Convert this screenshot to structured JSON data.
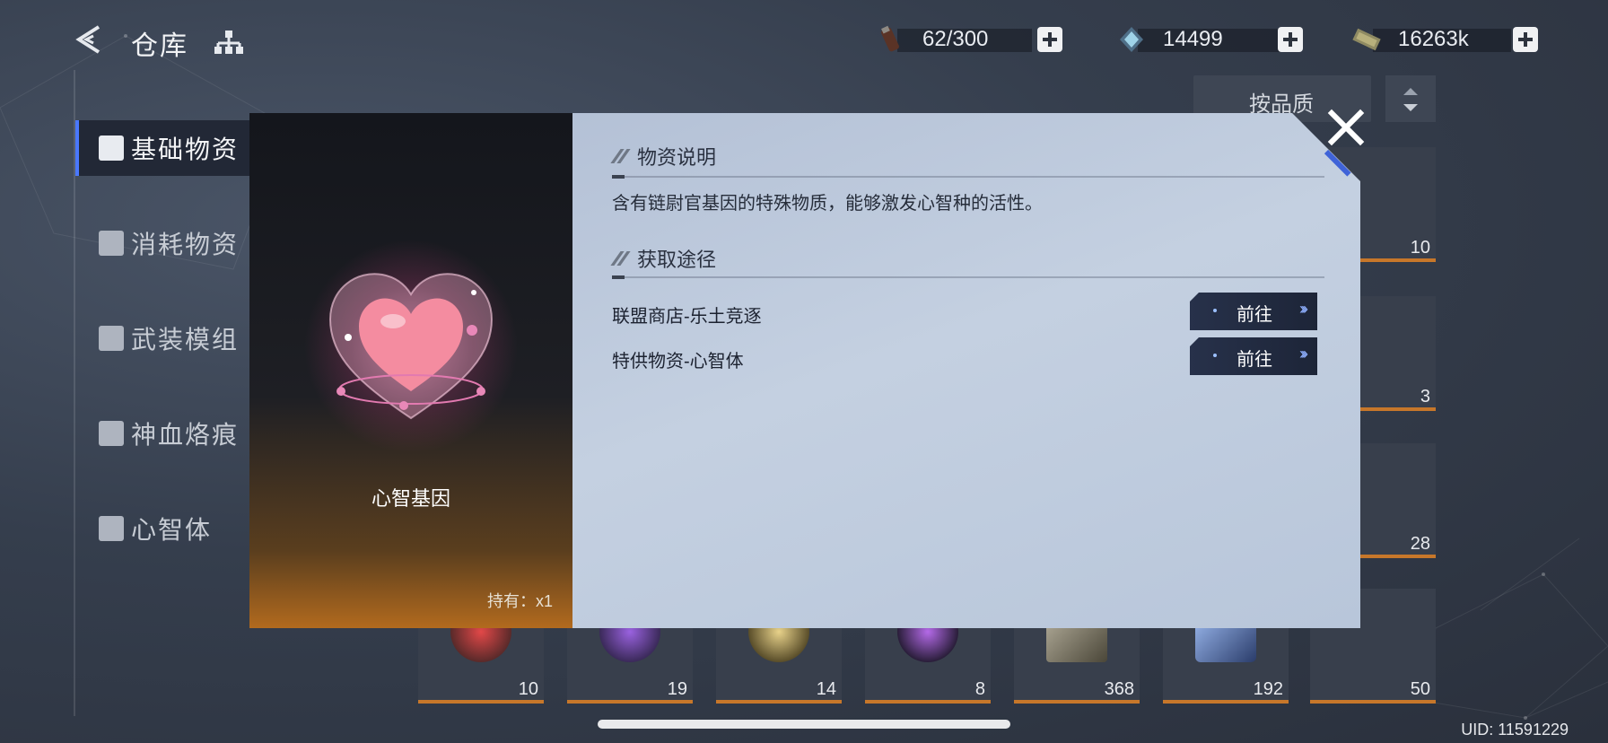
{
  "header": {
    "title": "仓库",
    "resources": [
      {
        "icon": "stamina-vial-icon",
        "value": "62/300"
      },
      {
        "icon": "crystal-icon",
        "value": "14499"
      },
      {
        "icon": "cash-icon",
        "value": "16263k"
      }
    ]
  },
  "sidebar": {
    "items": [
      {
        "label": "基础物资",
        "icon": "cube-icon",
        "active": true
      },
      {
        "label": "消耗物资",
        "icon": "battery-box-icon",
        "active": false
      },
      {
        "label": "武装模组",
        "icon": "module-icon",
        "active": false
      },
      {
        "label": "神血烙痕",
        "icon": "star-stamp-icon",
        "active": false
      },
      {
        "label": "心智体",
        "icon": "mind-body-icon",
        "active": false
      }
    ]
  },
  "sort": {
    "label": "按品质"
  },
  "grid": {
    "right_column_counts": [
      "10",
      "3",
      "28",
      "50"
    ],
    "bottom_row_counts": [
      "10",
      "19",
      "14",
      "8",
      "368",
      "192"
    ]
  },
  "modal": {
    "item_name": "心智基因",
    "owned": "持有：x1",
    "description_title": "物资说明",
    "description": "含有链尉官基因的特殊物质，能够激发心智种的活性。",
    "acquire_title": "获取途径",
    "routes": [
      {
        "label": "联盟商店-乐土竞逐",
        "button": "前往"
      },
      {
        "label": "特供物资-心智体",
        "button": "前往"
      }
    ]
  },
  "footer": {
    "uid": "UID: 11591229"
  },
  "colors": {
    "accent": "#4a78ff",
    "rarity_orange": "#c7772a",
    "panel_light": "#c4d0e1"
  }
}
